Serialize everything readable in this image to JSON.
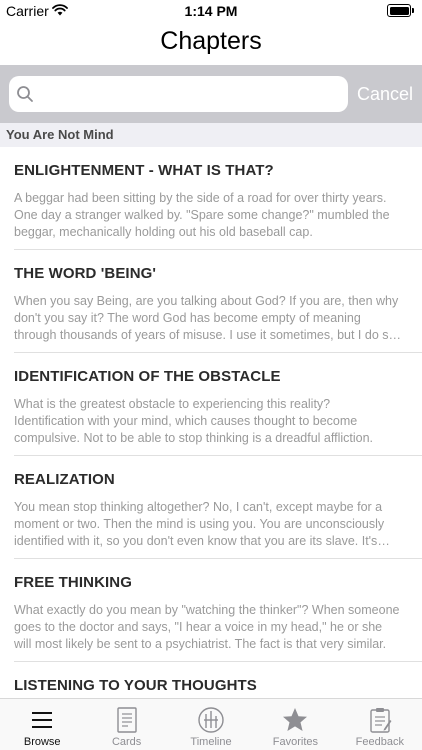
{
  "status": {
    "carrier": "Carrier",
    "time": "1:14 PM"
  },
  "nav": {
    "title": "Chapters"
  },
  "search": {
    "placeholder": "",
    "value": "",
    "cancel_label": "Cancel"
  },
  "section": {
    "title": "You Are Not Mind"
  },
  "chapters": [
    {
      "title": "ENLIGHTENMENT - WHAT IS THAT?",
      "preview": "A beggar had been sitting by the side of a road for over thirty years. One day a stranger walked by. \"Spare some change?\" mumbled the beggar, mechanically holding out his old baseball cap."
    },
    {
      "title": "THE WORD 'BEING'",
      "preview": "When you say Being, are you talking about God? If you are, then why don't you say it? The word God has become empty of meaning through thousands of years of misuse. I use it sometimes, but I do so sparingly."
    },
    {
      "title": "IDENTIFICATION OF THE OBSTACLE",
      "preview": "What is the greatest obstacle to experiencing this reality? Identification with your mind, which causes thought to become compulsive. Not to be able to stop thinking is a dreadful affliction."
    },
    {
      "title": "REALIZATION",
      "preview": "You mean stop thinking altogether? No, I can't, except maybe for a moment or two. Then the mind is using you. You are unconsciously identified with it, so you don't even know that you are its slave. It's almost as if you were possessed."
    },
    {
      "title": "FREE THINKING",
      "preview": "What exactly do you mean by \"watching the thinker\"? When someone goes to the doctor and says, \"I hear a voice in my head,\" he or she will most likely be sent to a psychiatrist. The fact is that very similar."
    },
    {
      "title": "LISTENING TO YOUR THOUGHTS",
      "preview": ""
    }
  ],
  "tabs": [
    {
      "label": "Browse",
      "icon": "list-icon",
      "active": true
    },
    {
      "label": "Cards",
      "icon": "card-icon",
      "active": false
    },
    {
      "label": "Timeline",
      "icon": "timeline-icon",
      "active": false
    },
    {
      "label": "Favorites",
      "icon": "star-icon",
      "active": false
    },
    {
      "label": "Feedback",
      "icon": "clipboard-icon",
      "active": false
    }
  ],
  "colors": {
    "accent": "#111111",
    "inactive": "#8e8e93",
    "search_bg": "#c9c9ce"
  }
}
